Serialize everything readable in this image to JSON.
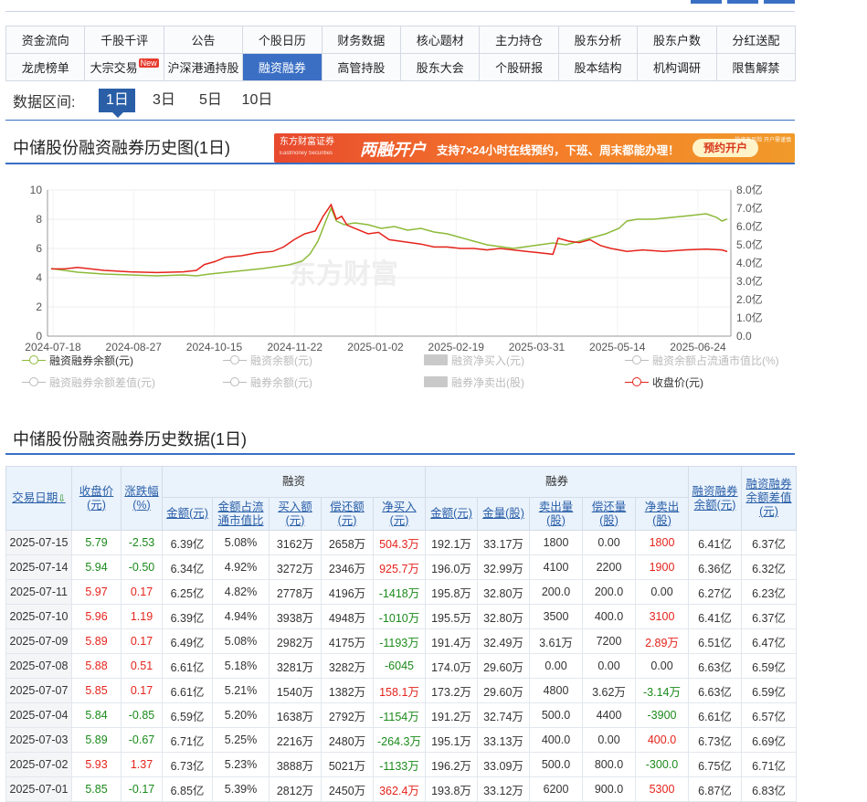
{
  "nav": {
    "row1": [
      "资金流向",
      "千股千评",
      "公告",
      "个股日历",
      "财务数据",
      "核心题材",
      "主力持仓",
      "股东分析",
      "股东户数",
      "分红送配"
    ],
    "row2": [
      "龙虎榜单",
      "大宗交易",
      "沪深港通持股",
      "融资融券",
      "高管持股",
      "股东大会",
      "个股研报",
      "股本结构",
      "机构调研",
      "限售解禁"
    ],
    "active_row2_index": 3,
    "new_badge": "New"
  },
  "range": {
    "label": "数据区间:",
    "options": [
      "1日",
      "3日",
      "5日",
      "10日"
    ],
    "active_index": 0
  },
  "chart_section": {
    "title": "中储股份融资融券历史图(1日)",
    "ad": {
      "brand": "东方财富证券",
      "brand_en": "Eastmoney Securities",
      "main": "两融开户",
      "sub": "支持7×24小时在线预约，下班、周末都能办理！",
      "cta": "预约开户",
      "small": "投资有风险 开户需谨慎"
    },
    "watermark": "东方财富"
  },
  "chart_data": {
    "type": "line",
    "x_ticks": [
      "2024-07-18",
      "2024-08-27",
      "2024-10-15",
      "2024-11-22",
      "2025-01-02",
      "2025-02-19",
      "2025-03-31",
      "2025-05-14",
      "2025-06-24"
    ],
    "y_left": {
      "min": 0,
      "max": 10,
      "ticks": [
        "0",
        "2",
        "4",
        "6",
        "8",
        "10"
      ]
    },
    "y_right": {
      "min": 0,
      "max": 8,
      "ticks": [
        "0.0",
        "1.0亿",
        "2.0亿",
        "3.0亿",
        "4.0亿",
        "5.0亿",
        "6.0亿",
        "7.0亿",
        "8.0亿"
      ]
    },
    "series": [
      {
        "name": "融资融券余额(元)",
        "axis": "right",
        "color": "#8cba38",
        "points": [
          [
            0,
            3.7
          ],
          [
            5,
            3.6
          ],
          [
            10,
            3.5
          ],
          [
            20,
            3.4
          ],
          [
            30,
            3.35
          ],
          [
            40,
            3.3
          ],
          [
            50,
            3.35
          ],
          [
            55,
            3.3
          ],
          [
            60,
            3.4
          ],
          [
            70,
            3.55
          ],
          [
            80,
            3.7
          ],
          [
            85,
            3.8
          ],
          [
            90,
            3.9
          ],
          [
            95,
            4.1
          ],
          [
            98,
            4.5
          ],
          [
            101,
            5.2
          ],
          [
            104,
            6.3
          ],
          [
            106,
            7.0
          ],
          [
            108,
            6.3
          ],
          [
            111,
            6.1
          ],
          [
            115,
            6.2
          ],
          [
            120,
            6.1
          ],
          [
            125,
            5.9
          ],
          [
            130,
            6.0
          ],
          [
            135,
            5.8
          ],
          [
            140,
            5.9
          ],
          [
            145,
            5.7
          ],
          [
            150,
            5.6
          ],
          [
            155,
            5.4
          ],
          [
            160,
            5.2
          ],
          [
            165,
            5.0
          ],
          [
            170,
            4.9
          ],
          [
            175,
            4.8
          ],
          [
            180,
            4.9
          ],
          [
            185,
            5.0
          ],
          [
            190,
            5.1
          ],
          [
            195,
            5.0
          ],
          [
            200,
            5.2
          ],
          [
            205,
            5.4
          ],
          [
            210,
            5.6
          ],
          [
            215,
            5.9
          ],
          [
            218,
            6.3
          ],
          [
            222,
            6.4
          ],
          [
            228,
            6.4
          ],
          [
            235,
            6.5
          ],
          [
            242,
            6.6
          ],
          [
            248,
            6.7
          ],
          [
            252,
            6.5
          ],
          [
            254,
            6.3
          ],
          [
            256,
            6.41
          ]
        ]
      },
      {
        "name": "收盘价(元)",
        "axis": "left",
        "color": "#e5231b",
        "points": [
          [
            0,
            4.6
          ],
          [
            5,
            4.6
          ],
          [
            10,
            4.7
          ],
          [
            20,
            4.5
          ],
          [
            30,
            4.4
          ],
          [
            40,
            4.35
          ],
          [
            50,
            4.4
          ],
          [
            55,
            4.5
          ],
          [
            58,
            4.9
          ],
          [
            62,
            5.1
          ],
          [
            66,
            5.4
          ],
          [
            72,
            5.5
          ],
          [
            78,
            5.7
          ],
          [
            84,
            5.8
          ],
          [
            88,
            6.1
          ],
          [
            92,
            6.6
          ],
          [
            96,
            7.0
          ],
          [
            100,
            7.2
          ],
          [
            103,
            8.2
          ],
          [
            106,
            9.0
          ],
          [
            108,
            8.0
          ],
          [
            110,
            8.2
          ],
          [
            112,
            7.6
          ],
          [
            116,
            7.3
          ],
          [
            120,
            7.0
          ],
          [
            124,
            7.1
          ],
          [
            128,
            6.6
          ],
          [
            132,
            6.5
          ],
          [
            136,
            6.4
          ],
          [
            140,
            6.3
          ],
          [
            145,
            6.1
          ],
          [
            150,
            6.1
          ],
          [
            155,
            6.0
          ],
          [
            160,
            6.0
          ],
          [
            165,
            5.9
          ],
          [
            170,
            6.0
          ],
          [
            175,
            5.9
          ],
          [
            180,
            5.8
          ],
          [
            185,
            5.7
          ],
          [
            190,
            5.6
          ],
          [
            192,
            6.7
          ],
          [
            196,
            6.5
          ],
          [
            200,
            6.4
          ],
          [
            204,
            6.6
          ],
          [
            208,
            6.2
          ],
          [
            212,
            6.0
          ],
          [
            218,
            5.8
          ],
          [
            224,
            5.9
          ],
          [
            232,
            5.8
          ],
          [
            240,
            5.9
          ],
          [
            248,
            5.95
          ],
          [
            254,
            5.9
          ],
          [
            256,
            5.79
          ]
        ]
      }
    ],
    "x_domain": [
      0,
      256
    ],
    "grid": true
  },
  "legend": {
    "items": [
      {
        "label": "融资融券余额(元)",
        "kind": "line",
        "on": true,
        "color": "#8cba38"
      },
      {
        "label": "融资余额(元)",
        "kind": "line",
        "on": false,
        "color": "#bbbbbb"
      },
      {
        "label": "融资净买入(元)",
        "kind": "box",
        "on": false,
        "color": "#bbbbbb"
      },
      {
        "label": "融资余额占流通市值比(%)",
        "kind": "line",
        "on": false,
        "color": "#bbbbbb"
      },
      {
        "label": "融资融券余额差值(元)",
        "kind": "line",
        "on": false,
        "color": "#bbbbbb"
      },
      {
        "label": "融券余额(元)",
        "kind": "line",
        "on": false,
        "color": "#bbbbbb"
      },
      {
        "label": "融券净卖出(股)",
        "kind": "box",
        "on": false,
        "color": "#bbbbbb"
      },
      {
        "label": "收盘价(元)",
        "kind": "line",
        "on": true,
        "color": "#e5231b"
      }
    ]
  },
  "table_section": {
    "title": "中储股份融资融券历史数据(1日)",
    "header_groups": {
      "rz": "融资",
      "rq": "融券"
    },
    "headers": {
      "date": "交易日期",
      "close": "收盘价(元)",
      "chg": "涨跌幅(%)",
      "rz": [
        "金额(元)",
        "金额占流通市值比",
        "买入额(元)",
        "偿还额(元)",
        "净买入(元)"
      ],
      "rq": [
        "金额(元)",
        "金量(股)",
        "卖出量(股)",
        "偿还量(股)",
        "净卖出(股)"
      ],
      "total": "融资融券余额(元)",
      "diff": "融资融券余额差值(元)"
    },
    "rows": [
      [
        "2025-07-15",
        "5.79",
        "-2.53",
        "6.39亿",
        "5.08%",
        "3162万",
        "2658万",
        "504.3万",
        "192.1万",
        "33.17万",
        "1800",
        "0.00",
        "1800",
        "6.41亿",
        "6.37亿"
      ],
      [
        "2025-07-14",
        "5.94",
        "-0.50",
        "6.34亿",
        "4.92%",
        "3272万",
        "2346万",
        "925.7万",
        "196.0万",
        "32.99万",
        "4100",
        "2200",
        "1900",
        "6.36亿",
        "6.32亿"
      ],
      [
        "2025-07-11",
        "5.97",
        "0.17",
        "6.25亿",
        "4.82%",
        "2778万",
        "4196万",
        "-1418万",
        "195.8万",
        "32.80万",
        "200.0",
        "200.0",
        "0.00",
        "6.27亿",
        "6.23亿"
      ],
      [
        "2025-07-10",
        "5.96",
        "1.19",
        "6.39亿",
        "4.94%",
        "3938万",
        "4948万",
        "-1010万",
        "195.5万",
        "32.80万",
        "3500",
        "400.0",
        "3100",
        "6.41亿",
        "6.37亿"
      ],
      [
        "2025-07-09",
        "5.89",
        "0.17",
        "6.49亿",
        "5.08%",
        "2982万",
        "4175万",
        "-1193万",
        "191.4万",
        "32.49万",
        "3.61万",
        "7200",
        "2.89万",
        "6.51亿",
        "6.47亿"
      ],
      [
        "2025-07-08",
        "5.88",
        "0.51",
        "6.61亿",
        "5.18%",
        "3281万",
        "3282万",
        "-6045",
        "174.0万",
        "29.60万",
        "0.00",
        "0.00",
        "0.00",
        "6.63亿",
        "6.59亿"
      ],
      [
        "2025-07-07",
        "5.85",
        "0.17",
        "6.61亿",
        "5.21%",
        "1540万",
        "1382万",
        "158.1万",
        "173.2万",
        "29.60万",
        "4800",
        "3.62万",
        "-3.14万",
        "6.63亿",
        "6.59亿"
      ],
      [
        "2025-07-04",
        "5.84",
        "-0.85",
        "6.59亿",
        "5.20%",
        "1638万",
        "2792万",
        "-1154万",
        "191.2万",
        "32.74万",
        "500.0",
        "4400",
        "-3900",
        "6.61亿",
        "6.57亿"
      ],
      [
        "2025-07-03",
        "5.89",
        "-0.67",
        "6.71亿",
        "5.25%",
        "2216万",
        "2480万",
        "-264.3万",
        "195.1万",
        "33.13万",
        "400.0",
        "0.00",
        "400.0",
        "6.73亿",
        "6.69亿"
      ],
      [
        "2025-07-02",
        "5.93",
        "1.37",
        "6.73亿",
        "5.23%",
        "3888万",
        "5021万",
        "-1133万",
        "196.2万",
        "33.09万",
        "500.0",
        "800.0",
        "-300.0",
        "6.75亿",
        "6.71亿"
      ],
      [
        "2025-07-01",
        "5.85",
        "-0.17",
        "6.85亿",
        "5.39%",
        "2812万",
        "2450万",
        "362.4万",
        "193.8万",
        "33.12万",
        "6200",
        "900.0",
        "5300",
        "6.87亿",
        "6.83亿"
      ]
    ]
  }
}
